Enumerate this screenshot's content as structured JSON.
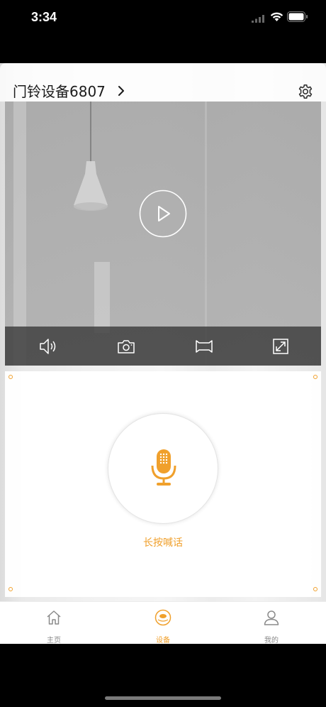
{
  "status_bar": {
    "time": "3:34",
    "icons": [
      "cellular-signal-icon",
      "wifi-icon",
      "battery-icon"
    ]
  },
  "header": {
    "device_title": "门铃设备6807",
    "icons": [
      "chevron-right-icon",
      "settings-gear-icon"
    ]
  },
  "video": {
    "play_icon": "play-icon",
    "controls": [
      {
        "name": "speaker",
        "icon": "speaker-icon"
      },
      {
        "name": "snapshot",
        "icon": "camera-icon"
      },
      {
        "name": "record",
        "icon": "video-record-icon"
      },
      {
        "name": "fullscreen",
        "icon": "fullscreen-icon"
      }
    ]
  },
  "talk": {
    "label": "长按喊话",
    "icon": "microphone-icon"
  },
  "tab_bar": {
    "tabs": [
      {
        "label": "主页",
        "icon": "home-icon",
        "active": false
      },
      {
        "label": "设备",
        "icon": "device-icon",
        "active": true
      },
      {
        "label": "我的",
        "icon": "user-icon",
        "active": false
      }
    ]
  },
  "colors": {
    "accent": "#f0a02c",
    "tab_inactive": "#8a8a8a",
    "control_bar": "#3c3c3c",
    "background": "#000000"
  }
}
